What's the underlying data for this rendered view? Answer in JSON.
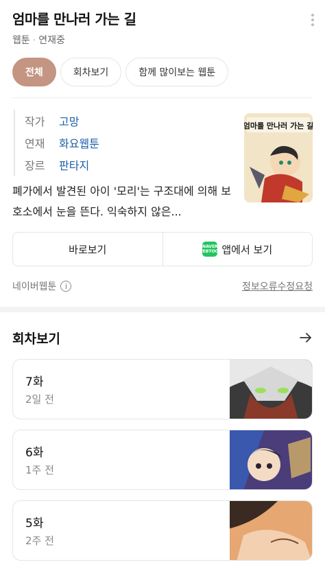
{
  "header": {
    "title": "엄마를 만나러 가는 길",
    "category": "웹툰",
    "status": "연재중",
    "more_icon": "more-vertical-icon"
  },
  "tabs": [
    {
      "label": "전체",
      "active": true
    },
    {
      "label": "회차보기",
      "active": false
    },
    {
      "label": "함께 많이보는 웹툰",
      "active": false
    }
  ],
  "info": {
    "author_label": "작가",
    "author": "고망",
    "serial_label": "연재",
    "serial": "화요웹툰",
    "genre_label": "장르",
    "genre": "판타지"
  },
  "cover": {
    "title_text": "엄마를 만나러 가는 길"
  },
  "description": "폐가에서 발견된 아이 '모리'는 구조대에 의해 보호소에서 눈을 뜬다. 익숙하지 않은...",
  "actions": {
    "view_now": "바로보기",
    "app_view": "앱에서 보기",
    "app_badge": "NAVER WEBTOON"
  },
  "footer": {
    "source": "네이버웹툰",
    "info_icon": "info-circle-icon",
    "report": "정보오류수정요청"
  },
  "episodes_section": {
    "title": "회차보기",
    "arrow_icon": "arrow-right-icon"
  },
  "episodes": [
    {
      "title": "7화",
      "date": "2일 전"
    },
    {
      "title": "6화",
      "date": "1주 전"
    },
    {
      "title": "5화",
      "date": "2주 전"
    }
  ],
  "colors": {
    "active_tab": "#c49583",
    "link": "#1b5fa8",
    "webtoon_green": "#23c45e"
  }
}
